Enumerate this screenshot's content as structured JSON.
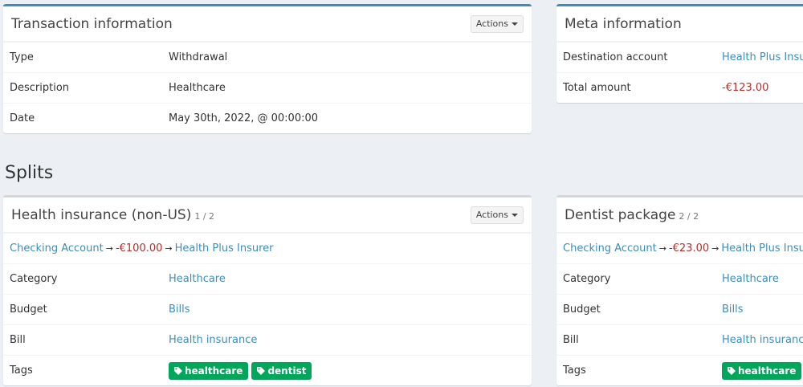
{
  "transaction": {
    "title": "Transaction information",
    "actions_label": "Actions",
    "rows": [
      {
        "label": "Type",
        "value": "Withdrawal"
      },
      {
        "label": "Description",
        "value": "Healthcare"
      },
      {
        "label": "Date",
        "value": "May 30th, 2022, @ 00:00:00"
      }
    ]
  },
  "meta": {
    "title": "Meta information",
    "rows": [
      {
        "label": "Destination account",
        "value": "Health Plus Insurer"
      },
      {
        "label": "Total amount",
        "value": "-€123.00"
      }
    ]
  },
  "splits_title": "Splits",
  "splits": [
    {
      "title": "Health insurance (non-US)",
      "count": "1 / 2",
      "actions_label": "Actions",
      "source": "Checking Account",
      "amount": "-€100.00",
      "destination": "Health Plus Insurer",
      "category_label": "Category",
      "category": "Healthcare",
      "budget_label": "Budget",
      "budget": "Bills",
      "bill_label": "Bill",
      "bill": "Health insurance",
      "tags_label": "Tags",
      "tags": [
        "healthcare",
        "dentist"
      ]
    },
    {
      "title": "Dentist package",
      "count": "2 / 2",
      "source": "Checking Account",
      "amount": "-€23.00",
      "destination": "Health Plus Insurer",
      "category_label": "Category",
      "category": "Healthcare",
      "budget_label": "Budget",
      "budget": "Bills",
      "bill_label": "Bill",
      "bill": "Health insurance",
      "tags_label": "Tags",
      "tags": [
        "healthcare"
      ]
    }
  ],
  "colors": {
    "accent": "#3c8dbc",
    "negative": "#b92b27",
    "tag": "#00a65a"
  }
}
